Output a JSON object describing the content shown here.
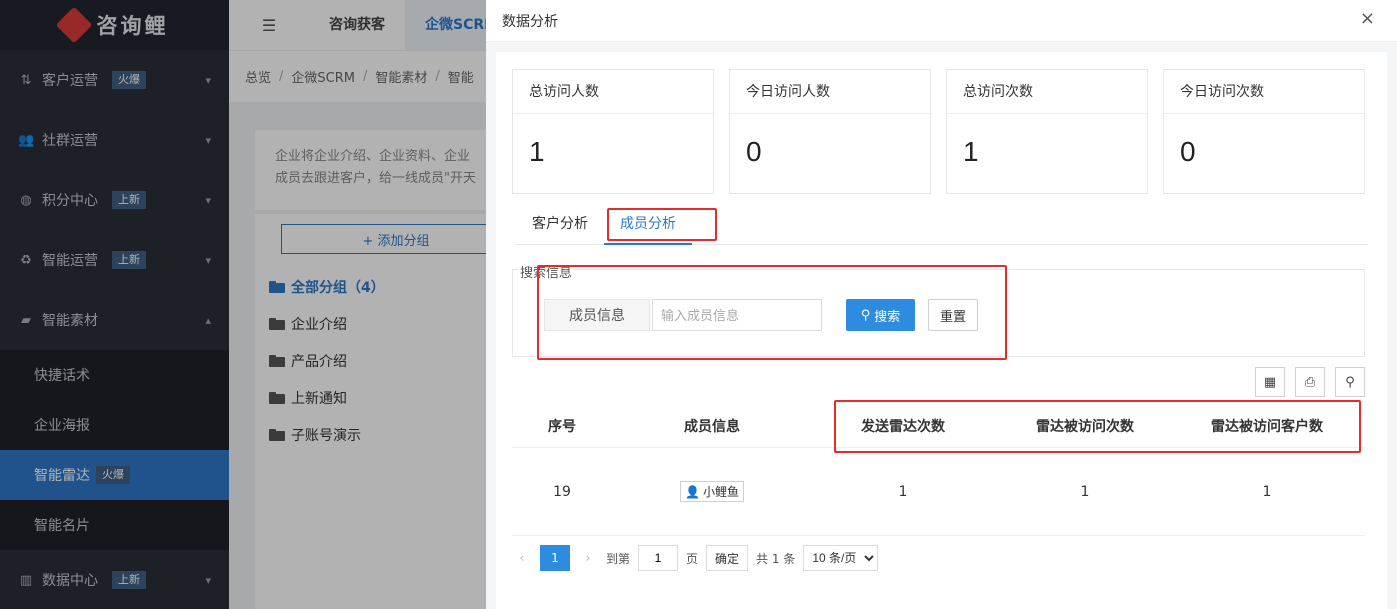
{
  "sidebar": {
    "brand": "咨询鲤",
    "items": [
      {
        "label": "客户运营",
        "badge": "火爆",
        "icon": "customer-ops-icon"
      },
      {
        "label": "社群运营",
        "badge": "",
        "icon": "community-icon"
      },
      {
        "label": "积分中心",
        "badge": "上新",
        "icon": "points-icon"
      },
      {
        "label": "智能运营",
        "badge": "上新",
        "icon": "smart-ops-icon"
      },
      {
        "label": "智能素材",
        "badge": "",
        "icon": "folder-icon"
      }
    ],
    "sub_items": [
      {
        "label": "快捷话术",
        "badge": ""
      },
      {
        "label": "企业海报",
        "badge": ""
      },
      {
        "label": "智能雷达",
        "badge": "火爆"
      },
      {
        "label": "智能名片",
        "badge": ""
      }
    ],
    "bottom_item": {
      "label": "数据中心",
      "badge": "上新",
      "icon": "chart-icon"
    }
  },
  "topbar": {
    "tabs": [
      "咨询获客",
      "企微SCRM"
    ]
  },
  "breadcrumb": [
    "总览",
    "企微SCRM",
    "智能素材",
    "智能"
  ],
  "notice": {
    "line1": "企业将企业介绍、企业资料、企业",
    "line2": "成员去跟进客户，给一线成员\"开天"
  },
  "groups": {
    "add_label": "+ 添加分组",
    "all_label": "全部分组（4）",
    "items": [
      "企业介绍",
      "产品介绍",
      "上新通知",
      "子账号演示"
    ]
  },
  "modal": {
    "title": "数据分析",
    "close": "×",
    "stats": [
      {
        "title": "总访问人数",
        "value": "1"
      },
      {
        "title": "今日访问人数",
        "value": "0"
      },
      {
        "title": "总访问次数",
        "value": "1"
      },
      {
        "title": "今日访问次数",
        "value": "0"
      }
    ],
    "tabs": [
      "客户分析",
      "成员分析"
    ],
    "search": {
      "section_title": "搜索信息",
      "field_label": "成员信息",
      "placeholder": "输入成员信息",
      "search_button": "搜索",
      "reset_button": "重置"
    },
    "table": {
      "headers": [
        "序号",
        "成员信息",
        "发送雷达次数",
        "雷达被访问次数",
        "雷达被访问客户数"
      ],
      "rows": [
        {
          "index": "19",
          "member": "小鲤鱼",
          "sent": "1",
          "visits": "1",
          "visitors": "1"
        }
      ]
    },
    "pager": {
      "current": "1",
      "goto_label": "到第",
      "goto_value": "1",
      "page_unit": "页",
      "confirm": "确定",
      "total": "共 1 条",
      "page_size": "10 条/页"
    }
  },
  "colors": {
    "accent": "#2e8ce0",
    "sidebar_bg": "#2b2f38",
    "highlight_red": "#e02d2d"
  }
}
